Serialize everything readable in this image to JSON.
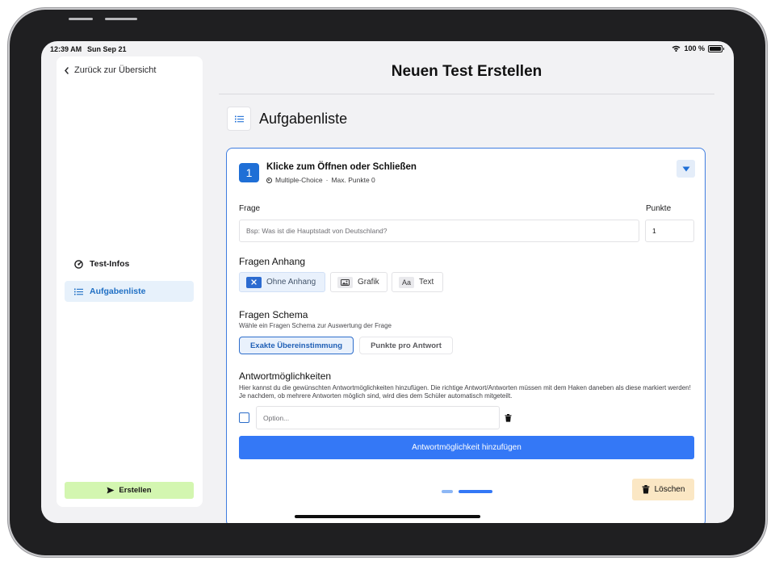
{
  "status_bar": {
    "time": "12:39 AM",
    "date": "Sun Sep 21",
    "battery": "100 %"
  },
  "sidebar": {
    "back_label": "Zurück zur Übersicht",
    "items": [
      {
        "label": "Test-Infos",
        "icon": "gauge-icon",
        "active": false
      },
      {
        "label": "Aufgabenliste",
        "icon": "list-icon",
        "active": true
      }
    ],
    "create_label": "Erstellen"
  },
  "page": {
    "title": "Neuen Test Erstellen",
    "section_title": "Aufgabenliste"
  },
  "question": {
    "number": "1",
    "title": "Klicke zum Öffnen oder Schließen",
    "type": "Multiple-Choice",
    "meta_separator": "·",
    "max_points": "Max. Punkte 0",
    "question_label": "Frage",
    "question_placeholder": "Bsp: Was ist die Hauptstadt von Deutschland?",
    "points_label": "Punkte",
    "points_value": "1"
  },
  "attachment": {
    "title": "Fragen Anhang",
    "options": [
      {
        "label": "Ohne Anhang",
        "icon": "close-icon",
        "selected": true
      },
      {
        "label": "Grafik",
        "icon": "image-icon",
        "selected": false
      },
      {
        "label": "Text",
        "icon": "text-icon",
        "icon_text": "Aa",
        "selected": false
      }
    ]
  },
  "schema": {
    "title": "Fragen Schema",
    "subtitle": "Wähle ein Fragen Schema zur Auswertung der Frage",
    "options": [
      {
        "label": "Exakte Übereinstimmung",
        "selected": true
      },
      {
        "label": "Punkte pro Antwort",
        "selected": false
      }
    ]
  },
  "answers": {
    "title": "Antwortmöglichkeiten",
    "description": "Hier kannst du die gewünschten Antwortmöglichkeiten hinzufügen. Die richtige Antwort/Antworten müssen mit dem Haken daneben als diese markiert werden! Je nachdem, ob mehrere Antworten möglich sind, wird dies dem Schüler automatisch mitgeteilt.",
    "option_placeholder": "Option...",
    "add_label": "Antwortmöglichkeit hinzufügen"
  },
  "delete_label": "Löschen",
  "colors": {
    "accent": "#1f6fd6",
    "primary_button": "#3478f6",
    "create_button": "#d3f6b0",
    "delete_button": "#fbe7c4",
    "active_nav": "#e7f1fb"
  }
}
